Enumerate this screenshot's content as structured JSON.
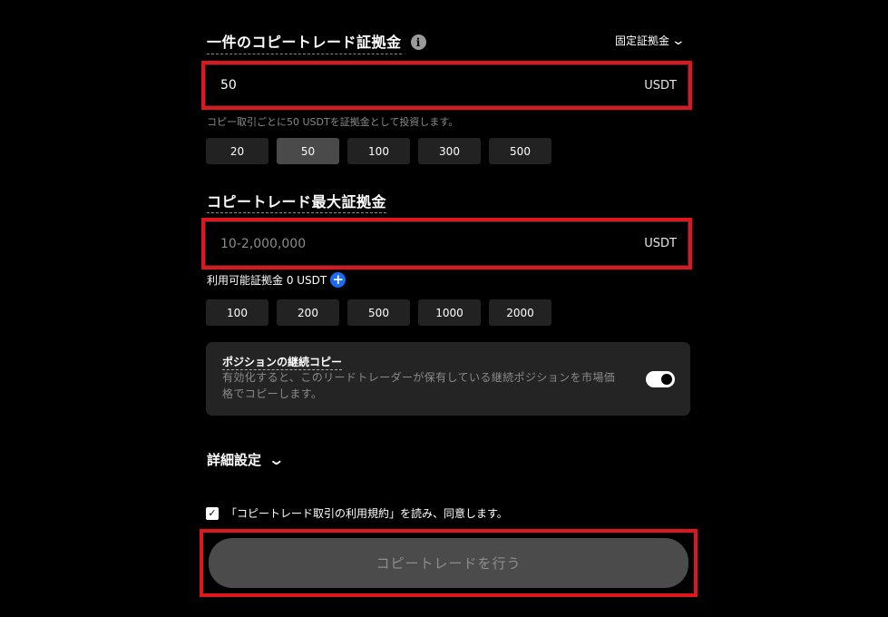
{
  "margin_section": {
    "title": "一件のコピートレード証拠金",
    "info_icon": "info-icon",
    "mode": "固定証拠金",
    "input_value": "50",
    "unit": "USDT",
    "hint": "コピー取引ごとに50 USDTを証拠金として投資します。",
    "presets": [
      "20",
      "50",
      "100",
      "300",
      "500"
    ],
    "selected_preset": "50"
  },
  "max_section": {
    "title": "コピートレード最大証拠金",
    "placeholder": "10-2,000,000",
    "unit": "USDT",
    "available": "利用可能証拠金 0 USDT",
    "presets": [
      "100",
      "200",
      "500",
      "1000",
      "2000"
    ]
  },
  "position_copy": {
    "title": "ポジションの継続コピー",
    "description_line1": "有効化すると、このリードトレーダーが保有している継続ポジションを市場価",
    "description_line2": "格でコピーします。",
    "enabled": true
  },
  "advanced": {
    "label": "詳細設定"
  },
  "agreement": {
    "checked": true,
    "text": "「コピートレード取引の利用規約」を読み、同意します。"
  },
  "submit": {
    "label": "コピートレードを行う"
  },
  "colors": {
    "highlight": "#e0161e",
    "accent_blue": "#1a6df0",
    "background": "#000000",
    "chip": "#222222",
    "chip_active": "#4a4a4a"
  }
}
